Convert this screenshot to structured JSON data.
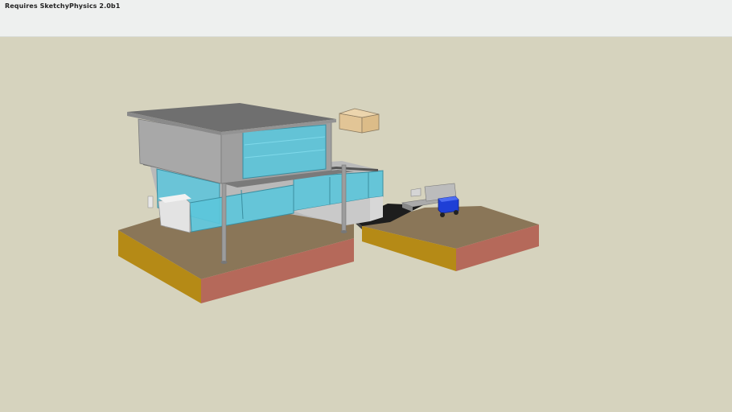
{
  "header": {
    "note": "Requires SketchyPhysics 2.0b1"
  },
  "scene": {
    "description_icon": "3d-model-viewport",
    "colors": {
      "background": "#d6d3be",
      "ground_top": "#8a7658",
      "ground_side_left": "#b58a16",
      "ground_side_right": "#b5695a",
      "glass": "#5cc6dc",
      "roof": "#6f6f6f",
      "wall": "#a9a9a9",
      "box": "#e2c596",
      "cart_blue": "#1e3fd6"
    }
  }
}
